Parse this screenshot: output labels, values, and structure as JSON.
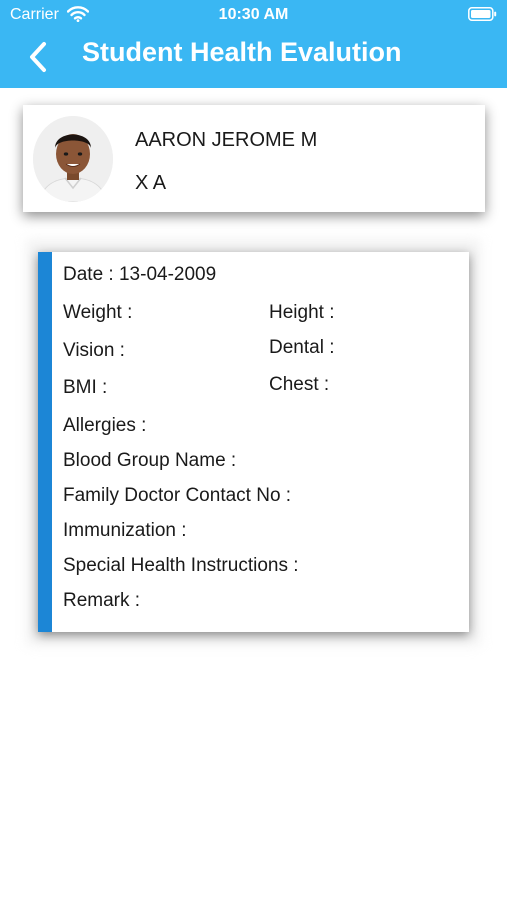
{
  "status_bar": {
    "carrier": "Carrier",
    "time": "10:30 AM"
  },
  "header": {
    "title": "Student Health Evalution",
    "back_icon": "chevron-left-icon",
    "background_color": "#3ab7f3"
  },
  "student": {
    "name": "AARON JEROME M",
    "class": "X A"
  },
  "health_record": {
    "date_label": "Date :",
    "date_value": "13-04-2009",
    "weight_label": "Weight :",
    "height_label": "Height :",
    "vision_label": "Vision :",
    "dental_label": "Dental :",
    "bmi_label": "BMI :",
    "chest_label": "Chest :",
    "allergies_label": "Allergies :",
    "blood_group_label": "Blood Group Name :",
    "family_doctor_label": "Family Doctor Contact No :",
    "immunization_label": "Immunization :",
    "special_instructions_label": "Special Health Instructions :",
    "remark_label": "Remark :",
    "accent_color": "#1c86d6"
  }
}
